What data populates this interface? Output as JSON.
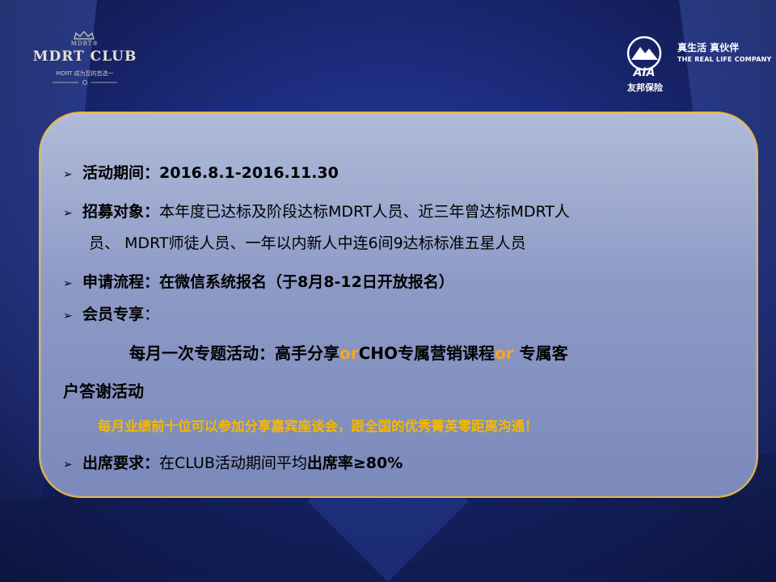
{
  "logo_mdrt": {
    "small": "MDRT®",
    "title": "MDRT CLUB",
    "tagline": "MDRT 成为您的首选一"
  },
  "logo_aia": {
    "slogan_cn": "真生活 真伙伴",
    "slogan_en": "THE REAL LIFE COMPANY",
    "brand": "AIA",
    "name_cn": "友邦保险"
  },
  "colors": {
    "background": "#1c2b7c",
    "panel": "#8d9ac6",
    "panel_border": "#e6b53a",
    "highlight": "#f5a623",
    "gold_text": "#f5b800"
  },
  "content": {
    "bullet_icon": "arrow-right-icon",
    "l1_label": "活动期间：",
    "l1_value": "2016.8.1-2016.11.30",
    "l2_label": "招募对象：",
    "l2_value": "本年度已达标及阶段达标MDRT人员、近三年曾达标MDRT人",
    "l3_value": "员、 MDRT师徒人员、一年以内新人中连6间9达标标准五星人员",
    "l4_label": "申请流程：",
    "l4_value": "在微信系统报名（于8月8-12日开放报名）",
    "l5_label": "会员专享",
    "l5_colon": "：",
    "l6_part1": "每月一次专题活动：高手分享",
    "l6_or1": "or",
    "l6_part2": "CHO专属营销课程",
    "l6_or2": "or",
    "l6_part3": " 专属客",
    "l7_value": "户答谢活动",
    "l8_value": "每月业绩前十位可以参加分享嘉宾座谈会，跟全国的优秀菁英零距离沟通！",
    "l9_label": "出席要求：",
    "l9_value": "在CLUB活动期间平均",
    "l9_bold": "出席率≥80%"
  }
}
